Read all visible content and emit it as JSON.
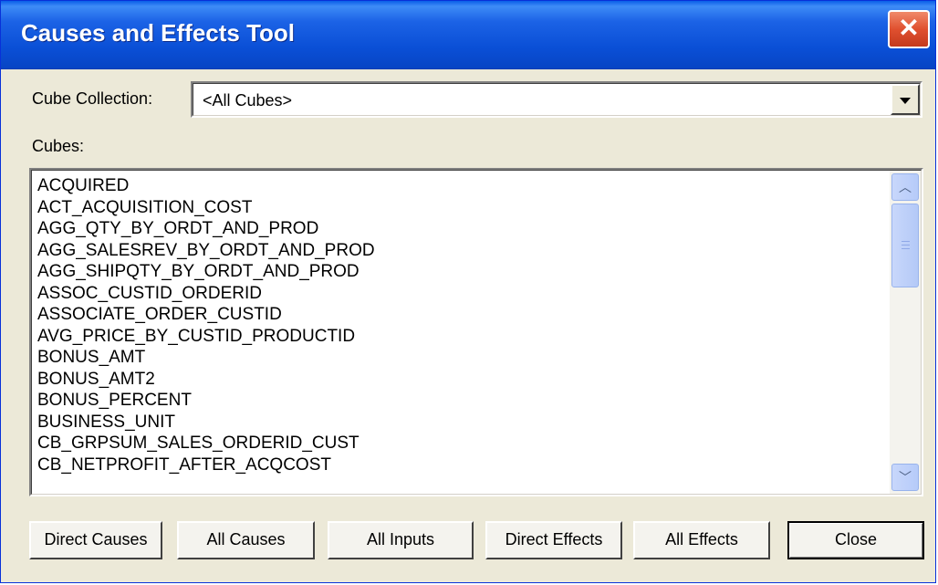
{
  "window": {
    "title": "Causes and Effects Tool",
    "close_glyph": "✕"
  },
  "form": {
    "collection_label": "Cube Collection:",
    "collection_value": "<All Cubes>",
    "cubes_label": "Cubes:"
  },
  "cubes": [
    "ACQUIRED",
    "ACT_ACQUISITION_COST",
    "AGG_QTY_BY_ORDT_AND_PROD",
    "AGG_SALESREV_BY_ORDT_AND_PROD",
    "AGG_SHIPQTY_BY_ORDT_AND_PROD",
    "ASSOC_CUSTID_ORDERID",
    "ASSOCIATE_ORDER_CUSTID",
    "AVG_PRICE_BY_CUSTID_PRODUCTID",
    "BONUS_AMT",
    "BONUS_AMT2",
    "BONUS_PERCENT",
    "BUSINESS_UNIT",
    "CB_GRPSUM_SALES_ORDERID_CUST",
    "CB_NETPROFIT_AFTER_ACQCOST"
  ],
  "buttons": {
    "direct_causes": "Direct Causes",
    "all_causes": "All Causes",
    "all_inputs": "All Inputs",
    "direct_effects": "Direct Effects",
    "all_effects": "All Effects",
    "close": "Close"
  },
  "icons": {
    "scroll_up": "chevron-up-icon",
    "scroll_down": "chevron-down-icon",
    "dropdown": "dropdown-arrow-icon"
  },
  "colors": {
    "titlebar": "#0a4fd6",
    "face": "#ece9d8",
    "close": "#e0502f"
  }
}
